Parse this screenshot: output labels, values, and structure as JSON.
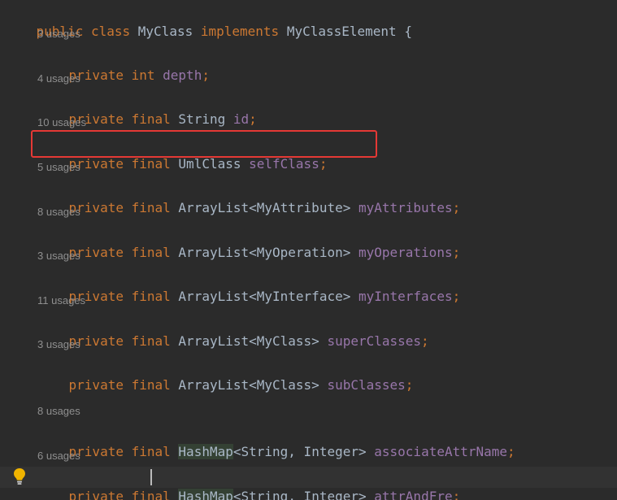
{
  "code": {
    "class_decl": {
      "kw_public": "public",
      "kw_class": "class",
      "class_name": "MyClass",
      "kw_implements": "implements",
      "interface_name": "MyClassElement",
      "brace": "{"
    },
    "fields": [
      {
        "usages": "3 usages",
        "modifiers": "private",
        "final": "",
        "type_text": "int",
        "name": "depth"
      },
      {
        "usages": "4 usages",
        "modifiers": "private",
        "final": "final",
        "type_text": "String",
        "name": "id"
      },
      {
        "usages": "10 usages",
        "modifiers": "private",
        "final": "final",
        "type_text": "UmlClass",
        "name": "selfClass"
      },
      {
        "usages": "5 usages",
        "modifiers": "private",
        "final": "final",
        "type_text": "ArrayList<MyAttribute>",
        "name": "myAttributes"
      },
      {
        "usages": "8 usages",
        "modifiers": "private",
        "final": "final",
        "type_text": "ArrayList<MyOperation>",
        "name": "myOperations"
      },
      {
        "usages": "3 usages",
        "modifiers": "private",
        "final": "final",
        "type_text": "ArrayList<MyInterface>",
        "name": "myInterfaces"
      },
      {
        "usages": "11 usages",
        "modifiers": "private",
        "final": "final",
        "type_text": "ArrayList<MyClass>",
        "name": "superClasses"
      },
      {
        "usages": "3 usages",
        "modifiers": "private",
        "final": "final",
        "type_text": "ArrayList<MyClass>",
        "name": "subClasses"
      },
      {
        "usages": "8 usages",
        "modifiers": "private",
        "final": "final",
        "type_text_head": "HashMap",
        "type_text_tail": "<String, Integer>",
        "name": "associateAttrName"
      },
      {
        "usages": "6 usages",
        "modifiers": "private",
        "final": "final",
        "type_text_head": "HashMap",
        "type_text_tail": "<String, Integer>",
        "name": "attrAndFre"
      }
    ],
    "semicolon": ";"
  },
  "colors": {
    "background": "#2b2b2b",
    "keyword": "#cc7832",
    "field": "#9876aa",
    "plain": "#a9b7c6",
    "hint": "#8f8f8f",
    "highlight_box": "#e53935",
    "bulb": "#f0b400"
  },
  "icons": {
    "intention_bulb": "lightbulb-icon"
  }
}
